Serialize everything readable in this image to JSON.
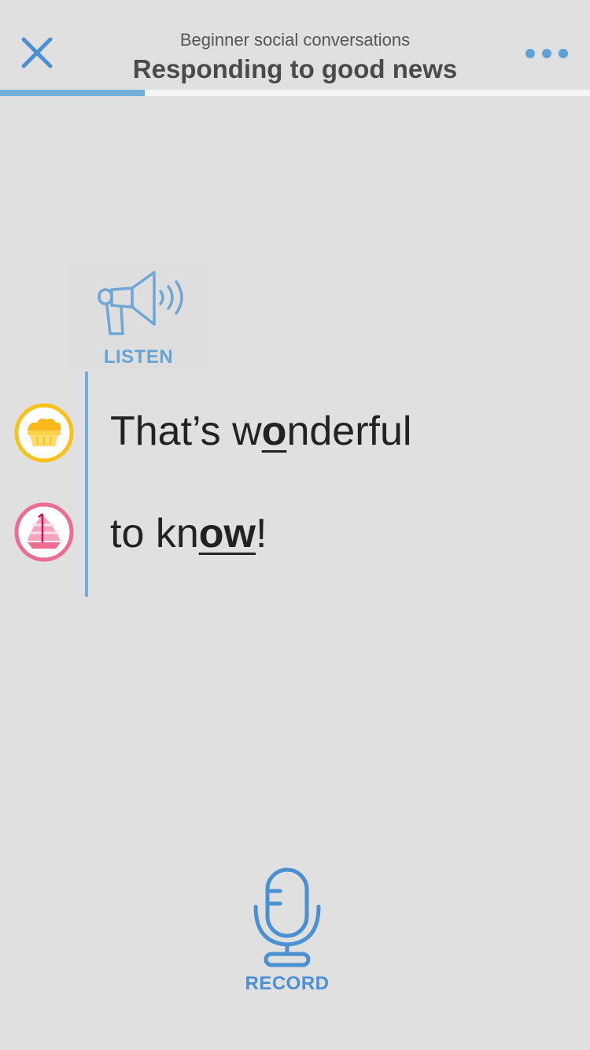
{
  "header": {
    "subtitle": "Beginner social conversations",
    "title": "Responding to good news",
    "progress_fraction": 0.245
  },
  "colors": {
    "background": "#e0e0e0",
    "accent_blue": "#4a90d2",
    "light_blue": "#73aedb",
    "speaker1_yellow": "#f8c21b",
    "speaker2_pink": "#ec6c94"
  },
  "icons": {
    "close": "close-icon",
    "more": "more-dots-icon",
    "listen": "megaphone-icon",
    "speaker1": "pie-avatar-icon",
    "speaker2": "sailboat-avatar-icon",
    "record": "microphone-icon"
  },
  "listen": {
    "label": "LISTEN"
  },
  "lines": [
    {
      "before": "That’s w",
      "stressed": "o",
      "after": "nderful"
    },
    {
      "before": "to kn",
      "stressed": "ow",
      "after": "!"
    }
  ],
  "record": {
    "label": "RECORD"
  }
}
